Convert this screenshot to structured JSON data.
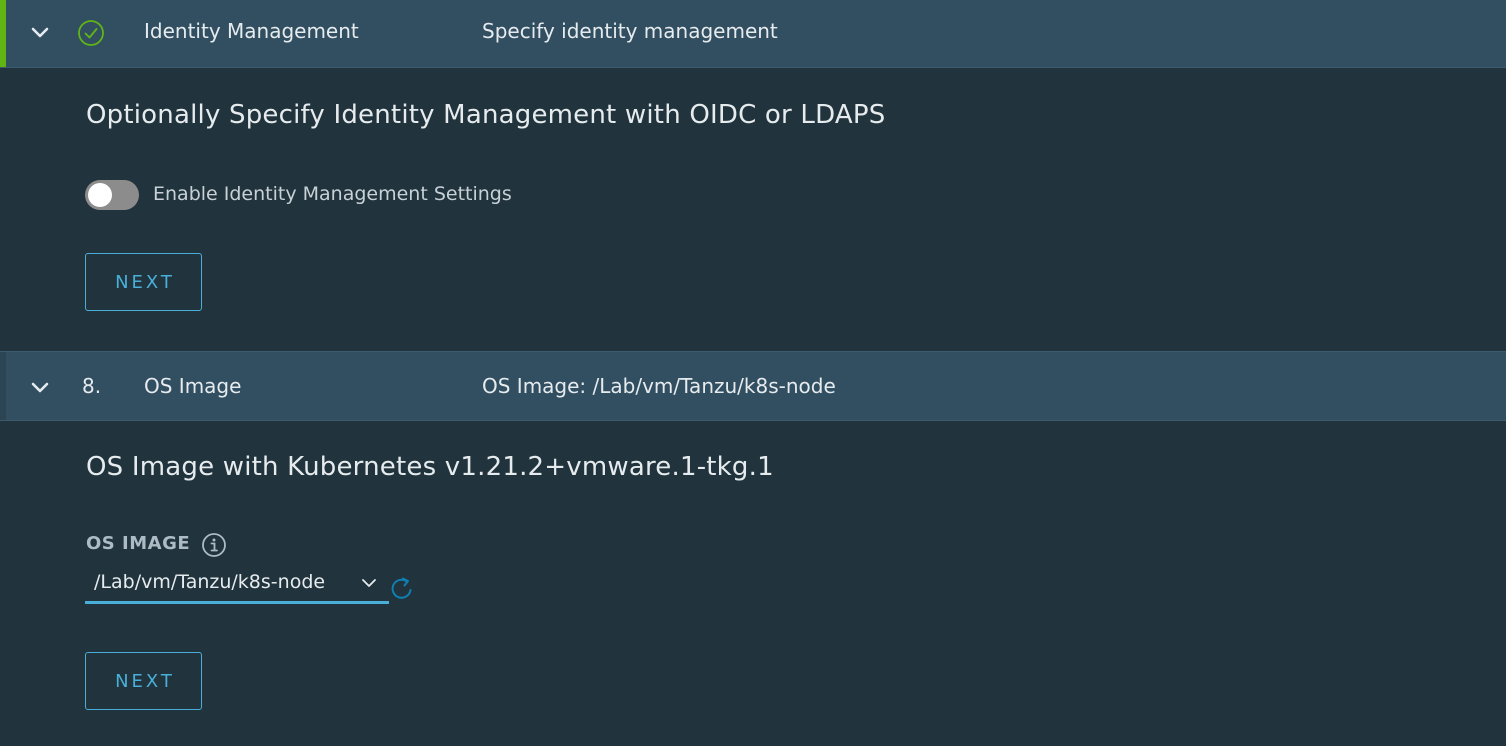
{
  "steps": [
    {
      "status": "complete",
      "title": "Identity Management",
      "summary": "Specify identity management",
      "heading": "Optionally Specify Identity Management with OIDC or LDAPS",
      "toggle": {
        "label": "Enable Identity Management Settings",
        "on": false
      },
      "next_label": "NEXT"
    },
    {
      "number": "8.",
      "title": "OS Image",
      "summary": "OS Image: /Lab/vm/Tanzu/k8s-node",
      "heading": "OS Image with Kubernetes v1.21.2+vmware.1-tkg.1",
      "field": {
        "label": "OS IMAGE",
        "value": "/Lab/vm/Tanzu/k8s-node"
      },
      "next_label": "NEXT"
    }
  ],
  "colors": {
    "background": "#21333c",
    "header": "#324f62",
    "accent_complete": "#60b515",
    "link": "#49afd9"
  },
  "icons": [
    "chevron-down-icon",
    "check-circle-icon",
    "info-circle-icon",
    "caret-down-icon",
    "refresh-icon"
  ]
}
